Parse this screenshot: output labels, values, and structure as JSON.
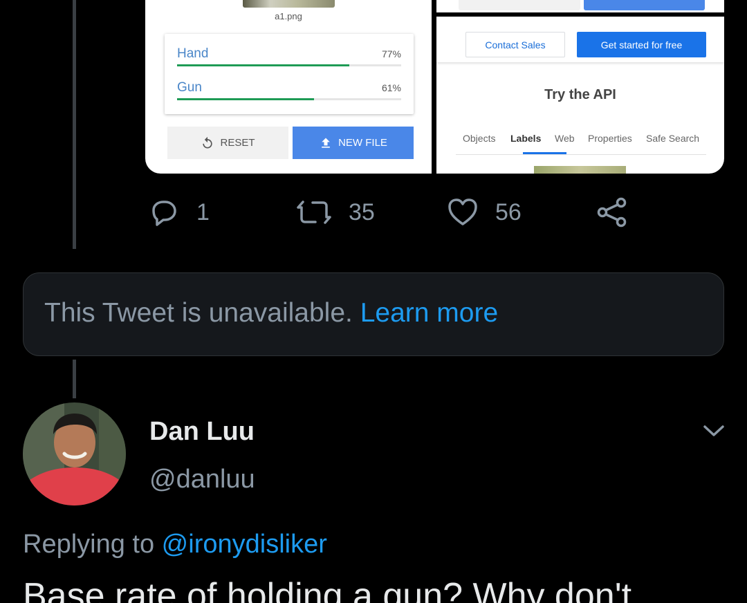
{
  "embedded_image": {
    "left": {
      "filename": "a1.png",
      "labels": [
        {
          "name": "Hand",
          "percent_text": "77%",
          "score": 0.77
        },
        {
          "name": "Gun",
          "percent_text": "61%",
          "score": 0.61
        }
      ],
      "reset_label": "RESET",
      "new_file_label": "NEW FILE"
    },
    "right": {
      "contact_sales_label": "Contact Sales",
      "get_started_label": "Get started for free",
      "title": "Try the API",
      "tabs": [
        {
          "label": "Objects",
          "active": false
        },
        {
          "label": "Labels",
          "active": true
        },
        {
          "label": "Web",
          "active": false
        },
        {
          "label": "Properties",
          "active": false
        },
        {
          "label": "Safe Search",
          "active": false
        }
      ],
      "accent_color": "#1a73e8"
    }
  },
  "tweet_actions": {
    "reply_count": "1",
    "retweet_count": "35",
    "like_count": "56"
  },
  "unavailable": {
    "message": "This Tweet is unavailable. ",
    "link": "Learn more"
  },
  "reply_tweet": {
    "display_name": "Dan Luu",
    "handle": "@danluu",
    "replying_prefix": "Replying to ",
    "replying_to": "@ironydisliker",
    "text": "Base rate of holding a gun? Why don't"
  },
  "colors": {
    "background": "#000000",
    "link": "#1d9bf0",
    "muted": "#8b98a5"
  }
}
